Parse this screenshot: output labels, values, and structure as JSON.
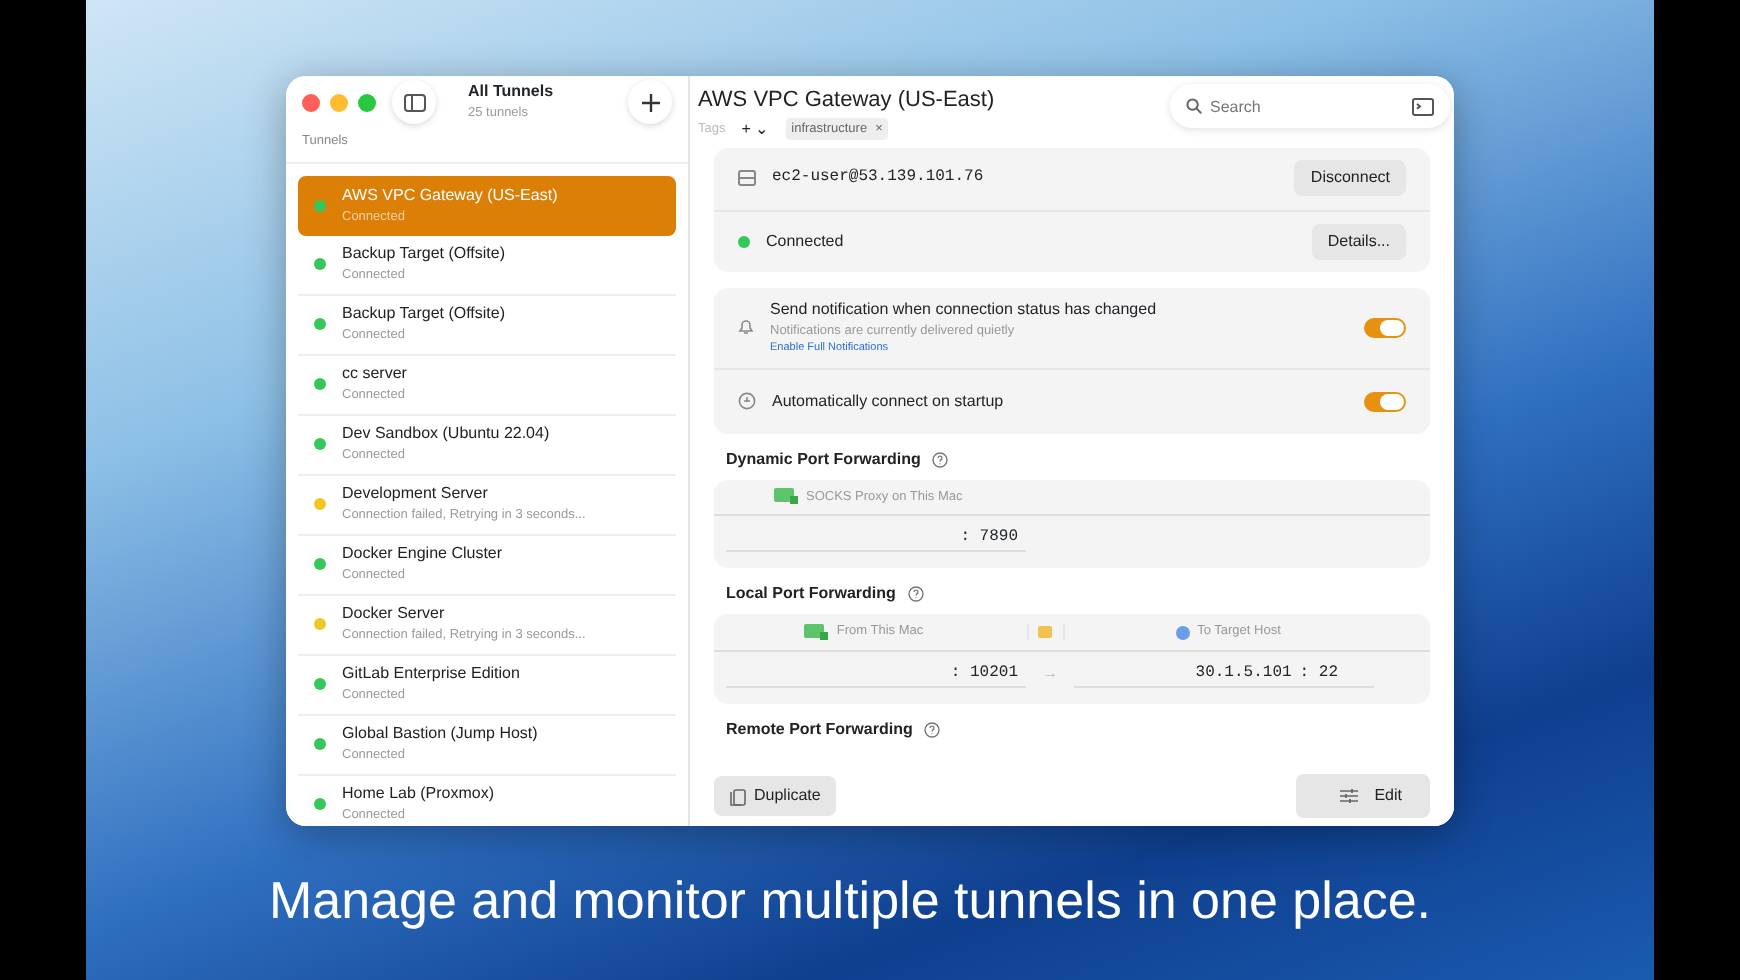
{
  "sidebar": {
    "title": "All Tunnels",
    "count": "25 tunnels",
    "section": "Tunnels",
    "items": [
      {
        "name": "AWS VPC Gateway (US-East)",
        "status": "Connected",
        "color": "#34c759",
        "selected": true
      },
      {
        "name": "Backup Target (Offsite)",
        "status": "Connected",
        "color": "#34c759",
        "selected": false
      },
      {
        "name": "Backup Target (Offsite)",
        "status": "Connected",
        "color": "#34c759",
        "selected": false
      },
      {
        "name": "cc server",
        "status": "Connected",
        "color": "#34c759",
        "selected": false
      },
      {
        "name": "Dev Sandbox (Ubuntu 22.04)",
        "status": "Connected",
        "color": "#34c759",
        "selected": false
      },
      {
        "name": "Development Server",
        "status": "Connection failed, Retrying in 3 seconds...",
        "color": "#f5c523",
        "selected": false
      },
      {
        "name": "Docker Engine Cluster",
        "status": "Connected",
        "color": "#34c759",
        "selected": false
      },
      {
        "name": "Docker Server",
        "status": "Connection failed, Retrying in 3 seconds...",
        "color": "#f5c523",
        "selected": false
      },
      {
        "name": "GitLab Enterprise Edition",
        "status": "Connected",
        "color": "#34c759",
        "selected": false
      },
      {
        "name": "Global Bastion (Jump Host)",
        "status": "Connected",
        "color": "#34c759",
        "selected": false
      },
      {
        "name": "Home Lab (Proxmox)",
        "status": "Connected",
        "color": "#34c759",
        "selected": false
      }
    ]
  },
  "detail": {
    "title": "AWS VPC Gateway (US-East)",
    "tags_label": "Tags",
    "tag_add": "+ ⌄",
    "tags": [
      {
        "label": "infrastructure",
        "remove": "×"
      }
    ],
    "search": {
      "placeholder": "Search"
    },
    "host": "ec2-user@53.139.101.76",
    "disconnect": "Disconnect",
    "status": "Connected",
    "connected": true,
    "details": "Details...",
    "settings": [
      {
        "kind": "bell",
        "label": "Send notification when connection status has changed",
        "note": "Notifications are currently delivered quietly",
        "link": "Enable Full Notifications",
        "on": true
      },
      {
        "kind": "power",
        "label": "Automatically connect on startup",
        "on": true
      }
    ],
    "dynamic": {
      "heading": "Dynamic Port Forwarding",
      "column": "SOCKS Proxy on This Mac",
      "port": ": 7890"
    },
    "local": {
      "heading": "Local Port Forwarding",
      "from": "From This Mac",
      "to": "To Target Host",
      "port": ": 10201",
      "arrow": "→",
      "host": "30.1.5.101",
      "host_port": ": 22"
    },
    "remote": {
      "heading": "Remote Port Forwarding"
    },
    "duplicate": "Duplicate",
    "edit": "Edit"
  },
  "caption": "Manage and monitor multiple tunnels in one place."
}
